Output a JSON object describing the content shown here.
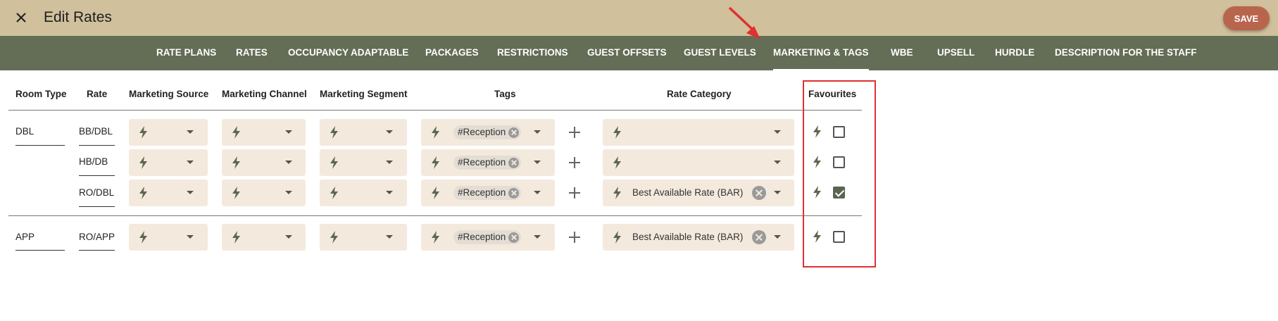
{
  "header": {
    "title": "Edit Rates",
    "save_label": "SAVE"
  },
  "tabs": [
    {
      "label": "RATE PLANS"
    },
    {
      "label": "RATES"
    },
    {
      "label": "OCCUPANCY ADAPTABLE"
    },
    {
      "label": "PACKAGES"
    },
    {
      "label": "RESTRICTIONS"
    },
    {
      "label": "GUEST OFFSETS"
    },
    {
      "label": "GUEST LEVELS"
    },
    {
      "label": "MARKETING & TAGS",
      "active": true
    },
    {
      "label": "WBE"
    },
    {
      "label": "UPSELL"
    },
    {
      "label": "HURDLE"
    },
    {
      "label": "DESCRIPTION FOR THE STAFF"
    }
  ],
  "columns": {
    "room_type": "Room Type",
    "rate": "Rate",
    "marketing_source": "Marketing Source",
    "marketing_channel": "Marketing Channel",
    "marketing_segment": "Marketing Segment",
    "tags": "Tags",
    "rate_category": "Rate Category",
    "favourites": "Favourites"
  },
  "groups": [
    {
      "room_type": "DBL",
      "rows": [
        {
          "rate": "BB/DBL",
          "tag": "#Reception",
          "rate_category": "",
          "favourite": false
        },
        {
          "rate": "HB/DB",
          "tag": "#Reception",
          "rate_category": "",
          "favourite": false
        },
        {
          "rate": "RO/DBL",
          "tag": "#Reception",
          "rate_category": "Best Available Rate (BAR)",
          "favourite": true
        }
      ]
    },
    {
      "room_type": "APP",
      "rows": [
        {
          "rate": "RO/APP",
          "tag": "#Reception",
          "rate_category": "Best Available Rate (BAR)",
          "favourite": false
        }
      ]
    }
  ],
  "colors": {
    "topbar": "#d0c09c",
    "navbar": "#646d55",
    "save": "#b9654d",
    "field": "#f4e9dd",
    "annotation": "#e03030"
  }
}
